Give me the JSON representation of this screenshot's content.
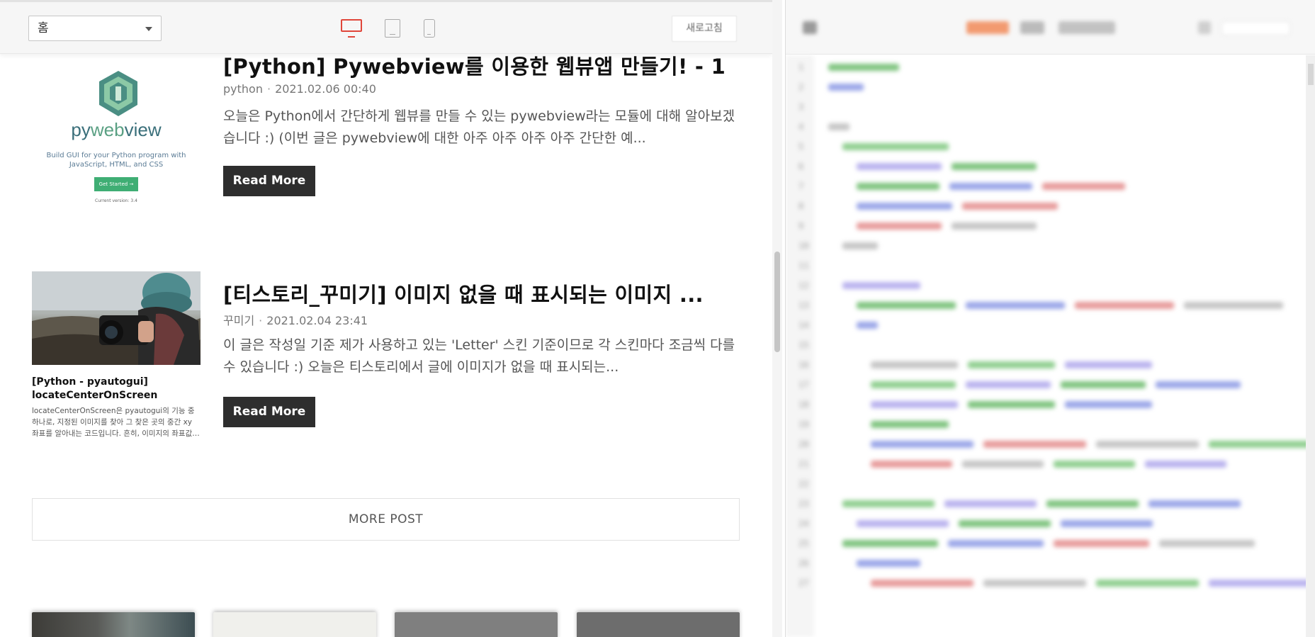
{
  "toolbar": {
    "page_select_value": "홈",
    "refresh_label": "새로고침"
  },
  "posts": [
    {
      "title": "[Python] Pywebview를 이용한 웹뷰앱 만들기! - 1",
      "category": "python",
      "date": "2021.02.06 00:40",
      "excerpt": "오늘은 Python에서 간단하게 웹뷰를 만들 수 있는 pywebview라는 모듈에 대해 알아보겠습니다 :) (이번 글은 pywebview에 대한 아주 아주 아주 아주 간단한 예...",
      "read_more": "Read More"
    },
    {
      "title": "[티스토리_꾸미기] 이미지 없을 때 표시되는 이미지 ...",
      "category": "꾸미기",
      "date": "2021.02.04 23:41",
      "excerpt": "이 글은 작성일 기준 제가 사용하고 있는 'Letter' 스킨 기준이므로 각 스킨마다 조금씩 다를 수 있습니다 :) 오늘은 티스토리에서 글에 이미지가 없을 때 표시되는...",
      "read_more": "Read More"
    }
  ],
  "pywebview_thumb": {
    "name_py": "py",
    "name_web": "web",
    "name_view": "view",
    "tagline": "Build GUI for your Python program with JavaScript, HTML, and CSS",
    "button": "Get Started →",
    "version": "Current version: 3.4"
  },
  "side_post": {
    "title": "[Python - pyautogui] locateCenterOnScreen",
    "excerpt": "locateCenterOnScreen은 pyautogui의 기능 중 하나로, 지정된 이미지를 찾아 그 찾은 곳의 중간 xy 좌표를 알아내는 코드입니다. 흔히, 이미지의 좌표값을 ..."
  },
  "more_post_label": "MORE POST",
  "colors": {
    "accent_device": "#e0463a",
    "read_more_bg": "#2e2e2e",
    "pywebview_green": "#3fae74"
  },
  "editor": {
    "line_numbers": [
      "1",
      "2",
      "3",
      "4",
      "5",
      "6",
      "7",
      "8",
      "9",
      "10",
      "11",
      "12",
      "13",
      "14",
      "15",
      "16",
      "17",
      "18",
      "19",
      "20",
      "21",
      "22",
      "23",
      "24",
      "25",
      "26",
      "27"
    ]
  }
}
